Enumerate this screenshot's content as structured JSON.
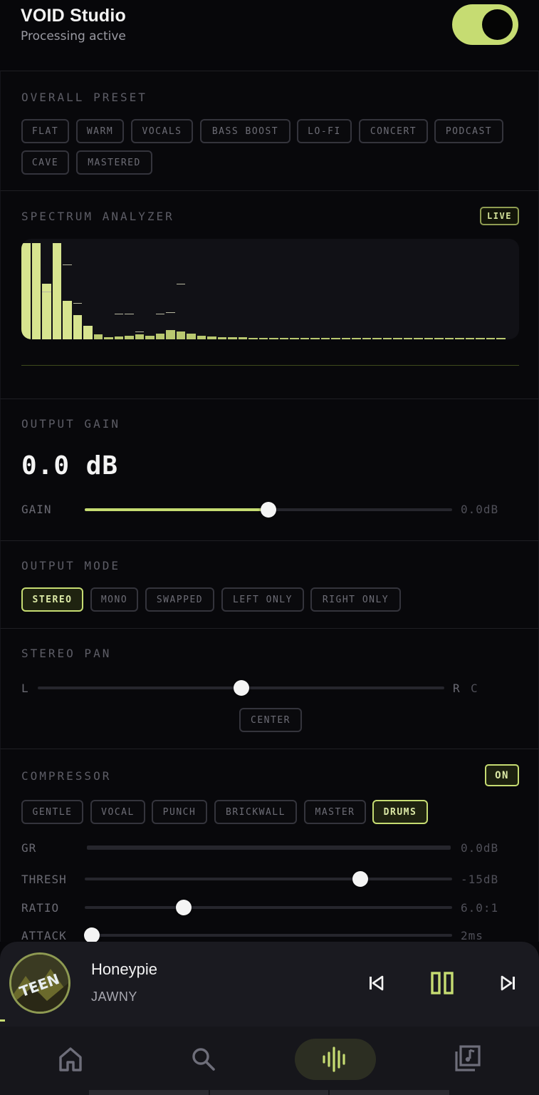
{
  "app": {
    "title": "VOID Studio",
    "status": "Processing active",
    "enabled": true
  },
  "preset": {
    "label": "OVERALL PRESET",
    "options": [
      "FLAT",
      "WARM",
      "VOCALS",
      "BASS BOOST",
      "LO-FI",
      "CONCERT",
      "PODCAST",
      "CAVE",
      "MASTERED"
    ]
  },
  "spectrum": {
    "label": "SPECTRUM ANALYZER",
    "badge": "LIVE",
    "levels": [
      1.0,
      1.0,
      0.58,
      1.0,
      0.4,
      0.25,
      0.14,
      0.05,
      0.02,
      0.03,
      0.04,
      0.05,
      0.04,
      0.06,
      0.1,
      0.08,
      0.06,
      0.04,
      0.03,
      0.02,
      0.02,
      0.02,
      0.01,
      0.01,
      0.01,
      0.01,
      0.01,
      0.01,
      0.01,
      0.01,
      0.01,
      0.01,
      0.01,
      0.01,
      0.01,
      0.01,
      0.01,
      0.01,
      0.01,
      0.01,
      0.01,
      0.01,
      0.01,
      0.01,
      0.01,
      0.01,
      0.01
    ],
    "peaks": [
      {
        "bar": 2,
        "level": 0.5
      },
      {
        "bar": 4,
        "level": 0.78
      },
      {
        "bar": 5,
        "level": 0.38
      },
      {
        "bar": 9,
        "level": 0.27
      },
      {
        "bar": 10,
        "level": 0.27
      },
      {
        "bar": 11,
        "level": 0.08
      },
      {
        "bar": 13,
        "level": 0.27
      },
      {
        "bar": 14,
        "level": 0.28
      },
      {
        "bar": 15,
        "level": 0.58
      }
    ]
  },
  "gain": {
    "label": "OUTPUT GAIN",
    "display": "0.0 dB",
    "row_label": "GAIN",
    "value_label": "0.0dB",
    "position": 0.5
  },
  "output_mode": {
    "label": "OUTPUT MODE",
    "options": [
      "STEREO",
      "MONO",
      "SWAPPED",
      "LEFT ONLY",
      "RIGHT ONLY"
    ],
    "selected": "STEREO"
  },
  "pan": {
    "label": "STEREO PAN",
    "left": "L",
    "right": "R",
    "value_label": "C",
    "position": 0.5,
    "center_button": "CENTER"
  },
  "compressor": {
    "label": "COMPRESSOR",
    "toggle": "ON",
    "presets": [
      "GENTLE",
      "VOCAL",
      "PUNCH",
      "BRICKWALL",
      "MASTER",
      "DRUMS"
    ],
    "selected": "DRUMS",
    "gr": {
      "label": "GR",
      "value": "0.0dB",
      "fraction": 0
    },
    "thresh": {
      "label": "THRESH",
      "value": "-15dB",
      "position": 0.75
    },
    "ratio": {
      "label": "RATIO",
      "value": "6.0:1",
      "position": 0.27
    },
    "attack": {
      "label": "ATTACK",
      "value": "2ms",
      "position": 0.02
    }
  },
  "now_playing": {
    "title": "Honeypie",
    "artist": "JAWNY",
    "art_text": "TEEN",
    "progress": 0.01
  },
  "nav": {
    "items": [
      "home-icon",
      "search-icon",
      "equalizer-icon",
      "library-icon"
    ],
    "active": "equalizer-icon"
  },
  "colors": {
    "accent": "#c6dc72",
    "background": "#07070a",
    "muted": "#5d5d66"
  }
}
